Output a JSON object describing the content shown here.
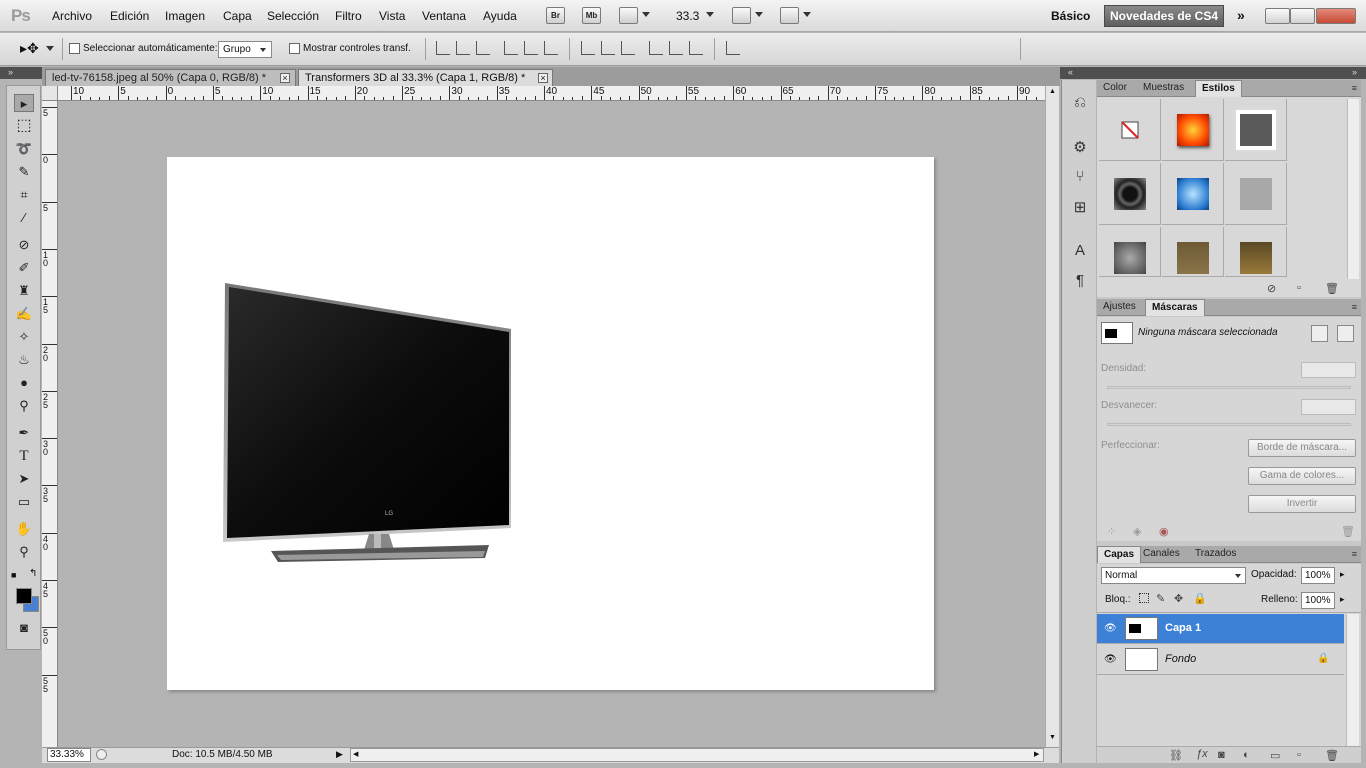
{
  "app": {
    "logo": "Ps"
  },
  "menu": [
    "Archivo",
    "Edición",
    "Imagen",
    "Capa",
    "Selección",
    "Filtro",
    "Vista",
    "Ventana",
    "Ayuda"
  ],
  "appbar": {
    "bridge": "Br",
    "minibridge": "Mb",
    "zoom": "33.3"
  },
  "workspace": {
    "basic": "Básico",
    "cs4": "Novedades de CS4"
  },
  "options": {
    "auto_select_label": "Seleccionar automáticamente:",
    "auto_select_value": "Grupo",
    "show_transform_label": "Mostrar controles transf."
  },
  "tabs": [
    {
      "label": "led-tv-76158.jpeg al 50% (Capa 0, RGB/8) *",
      "active": false
    },
    {
      "label": "Transformers 3D al 33.3% (Capa 1, RGB/8) *",
      "active": true
    }
  ],
  "ruler": {
    "h": [
      "10",
      "5",
      "0",
      "5",
      "10",
      "15",
      "20",
      "25",
      "30",
      "35",
      "40",
      "45",
      "50",
      "55",
      "60",
      "65",
      "70",
      "75",
      "80",
      "85",
      "90"
    ],
    "v": [
      "5",
      "0",
      "5",
      "1 0",
      "1 5",
      "2 0",
      "2 5",
      "3 0",
      "3 5",
      "4 0",
      "4 5",
      "5 0",
      "5 5"
    ]
  },
  "canvas": {
    "logo_text": "LG"
  },
  "status": {
    "zoom": "33.33%",
    "doc": "Doc: 10.5 MB/4.50 MB"
  },
  "styles_panel": {
    "tabs": [
      "Color",
      "Muestras",
      "Estilos"
    ],
    "active": "Estilos"
  },
  "masks_panel": {
    "tabs": [
      "Ajustes",
      "Máscaras"
    ],
    "active": "Máscaras",
    "status": "Ninguna máscara seleccionada",
    "density_label": "Densidad:",
    "feather_label": "Desvanecer:",
    "refine_label": "Perfeccionar:",
    "btn_edge": "Borde de máscara...",
    "btn_color": "Gama de colores...",
    "btn_invert": "Invertir"
  },
  "layers_panel": {
    "tabs": [
      "Capas",
      "Canales",
      "Trazados"
    ],
    "active": "Capas",
    "blend_mode": "Normal",
    "opacity_label": "Opacidad:",
    "opacity_value": "100%",
    "lock_label": "Bloq.:",
    "fill_label": "Relleno:",
    "fill_value": "100%",
    "layers": [
      {
        "name": "Capa 1",
        "selected": true,
        "visible": true
      },
      {
        "name": "Fondo",
        "selected": false,
        "visible": true,
        "locked": true
      }
    ]
  }
}
